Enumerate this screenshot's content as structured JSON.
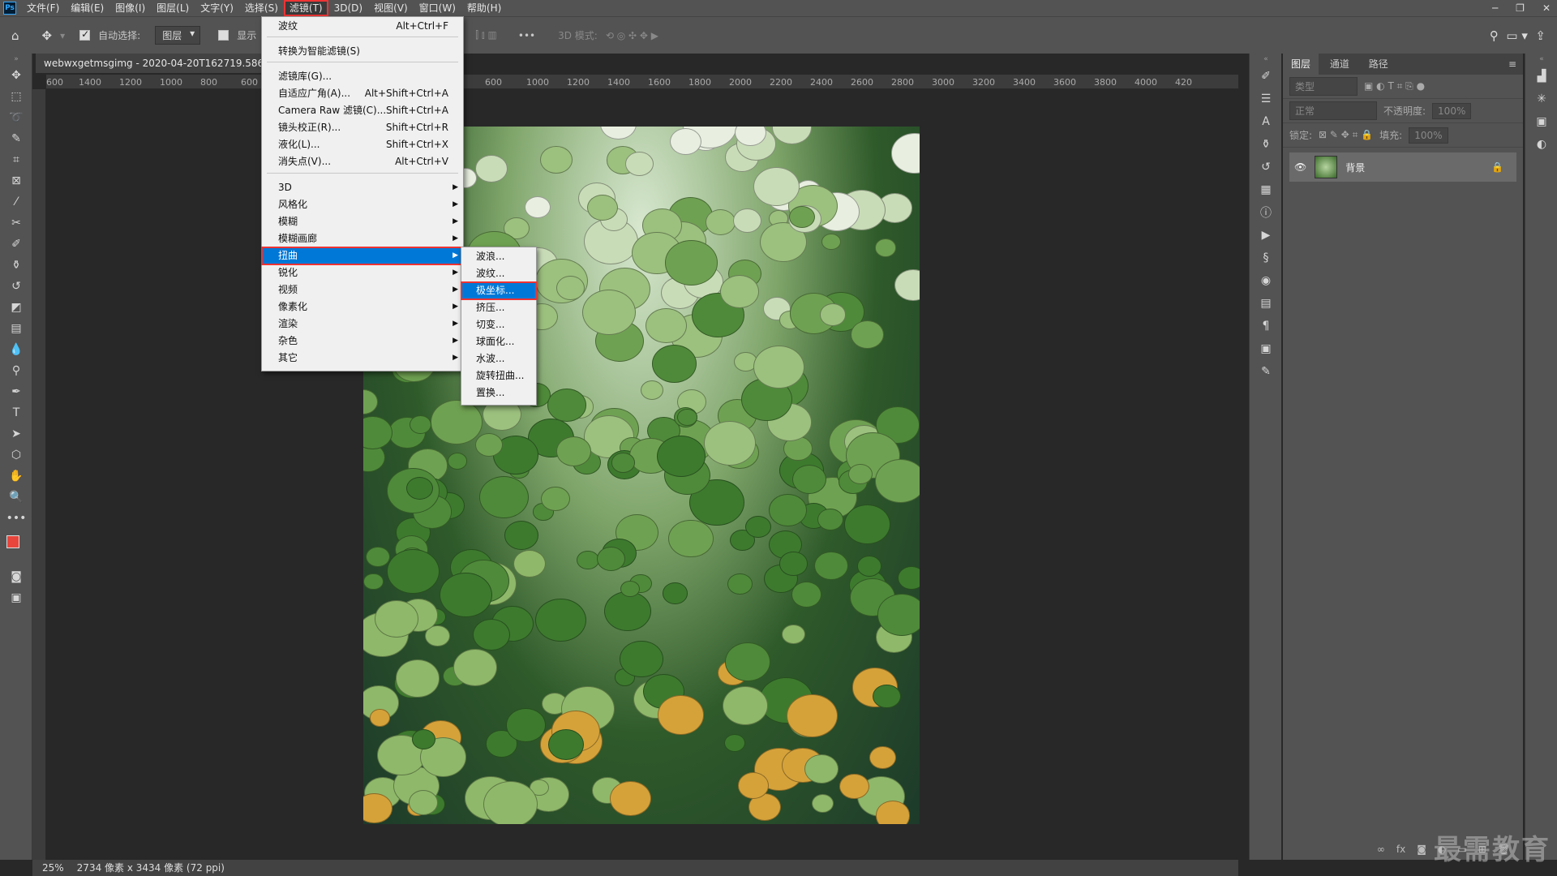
{
  "menubar": {
    "logo": "Ps",
    "items": [
      "文件(F)",
      "编辑(E)",
      "图像(I)",
      "图层(L)",
      "文字(Y)",
      "选择(S)",
      "滤镜(T)",
      "3D(D)",
      "视图(V)",
      "窗口(W)",
      "帮助(H)"
    ],
    "active_index": 6,
    "window_controls": [
      "─",
      "❐",
      "✕"
    ]
  },
  "options_bar": {
    "auto_select_label": "自动选择:",
    "auto_select_checked": true,
    "auto_select_value": "图层",
    "show_transform_label": "显示",
    "mode_3d_label": "3D 模式:",
    "more_label": "•••"
  },
  "document": {
    "tab_title": "webwxgetmsgimg - 2020-04-20T162719.586.jpg",
    "ruler_left": [
      "600",
      "1400",
      "1200",
      "1000",
      "800",
      "600"
    ],
    "ruler_right": [
      "600",
      "1000",
      "1200",
      "1400",
      "1600",
      "1800",
      "2000",
      "2200",
      "2400",
      "2600",
      "2800",
      "3000",
      "3200",
      "3400",
      "3600",
      "3800",
      "4000",
      "420"
    ]
  },
  "filter_menu": {
    "items": [
      {
        "label": "波纹",
        "shortcut": "Alt+Ctrl+F"
      },
      {
        "label": "转换为智能滤镜(S)",
        "shortcut": ""
      },
      {
        "label": "滤镜库(G)...",
        "shortcut": ""
      },
      {
        "label": "自适应广角(A)...",
        "shortcut": "Alt+Shift+Ctrl+A"
      },
      {
        "label": "Camera Raw 滤镜(C)...",
        "shortcut": "Shift+Ctrl+A"
      },
      {
        "label": "镜头校正(R)...",
        "shortcut": "Shift+Ctrl+R"
      },
      {
        "label": "液化(L)...",
        "shortcut": "Shift+Ctrl+X"
      },
      {
        "label": "消失点(V)...",
        "shortcut": "Alt+Ctrl+V"
      },
      {
        "label": "3D"
      },
      {
        "label": "风格化"
      },
      {
        "label": "模糊"
      },
      {
        "label": "模糊画廊"
      },
      {
        "label": "扭曲"
      },
      {
        "label": "锐化"
      },
      {
        "label": "视频"
      },
      {
        "label": "像素化"
      },
      {
        "label": "渲染"
      },
      {
        "label": "杂色"
      },
      {
        "label": "其它"
      }
    ],
    "highlighted": "扭曲"
  },
  "distort_submenu": {
    "items": [
      "波浪...",
      "波纹...",
      "极坐标...",
      "挤压...",
      "切变...",
      "球面化...",
      "水波...",
      "旋转扭曲...",
      "置换..."
    ],
    "highlighted": "极坐标..."
  },
  "status_bar": {
    "zoom": "25%",
    "doc_info": "2734 像素 x 3434 像素 (72 ppi)"
  },
  "layers_panel": {
    "tabs": [
      "图层",
      "通道",
      "路径"
    ],
    "active_tab": "图层",
    "filter_placeholder": "类型",
    "blend_mode": "正常",
    "opacity_label": "不透明度:",
    "opacity_value": "100%",
    "lock_label": "锁定:",
    "fill_label": "填充:",
    "fill_value": "100%",
    "layer_name": "背景"
  },
  "watermark": "最需教育"
}
